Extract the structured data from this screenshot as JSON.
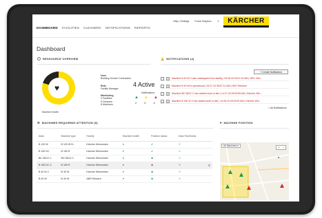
{
  "nav": [
    "DASHBOARD",
    "FACILITIES",
    "CLEANERS",
    "NOTIFICATIONS",
    "REPORTS"
  ],
  "toplinks": {
    "help": "Help | Settings",
    "user": "Frank Simpson"
  },
  "brand": "KÄRCHER",
  "title": "Dashboard",
  "resource": {
    "header": "RESSOURCE OVERVIEW",
    "machine_health_label": "Machine health",
    "user": {
      "label": "User",
      "value": "Building Service Contractors"
    },
    "role": {
      "label": "Role",
      "value": "Facility Manager"
    },
    "monitoring": {
      "label": "Monitoring",
      "facilities": "3 Facilities",
      "cleaners": "5 Cleaners",
      "machines": "8 Machines"
    }
  },
  "notifications": {
    "header": "NOTIFICATIONS (4)",
    "active": "4 Active",
    "status_label": "Notifications",
    "counts": [
      "2",
      "0",
      "4"
    ],
    "create_button": "+ Create Notification",
    "all_link": "> All Notifications",
    "items": [
      "Machine B 40 W 0 was unassigned from facility | 03.06.15 09:47:43 AM | NEG Geb...",
      "Machine B 40 W is operational | 15.07.15 08:57:14 AM | NEG Reinach",
      "Machine BD 38/12 C has started work in site | 14.07.15 09:09:55 AM | Kärcher Win...",
      "Machine B 150 W 2 has started work in site | 10.06.15 09:09:32 AM | Kärcher Win..."
    ]
  },
  "attention": {
    "header": "MACHINES REQUIRING ATTENTION (5)",
    "columns": [
      "Alias",
      "Machine type",
      "Facility",
      "Machine health",
      "Position status",
      "Data Timeliness"
    ],
    "rows": [
      {
        "alias": "B 120 W",
        "type": "B 120 W B...",
        "facility": "Kärcher Winnenden"
      },
      {
        "alias": "B 150 DC",
        "type": "B 150 R",
        "facility": "Kärcher Winnenden"
      },
      {
        "alias": "BD 38/12 C",
        "type": "BD 38/12 C",
        "facility": "Kärcher Winnenden"
      },
      {
        "alias": "B 150 DC 2",
        "type": "B 150 R",
        "facility": "Kärcher Winnenden"
      },
      {
        "alias": "B 40 W 2",
        "type": "B 40 W",
        "facility": "Kärcher Winnenden"
      },
      {
        "alias": "B 40 W",
        "type": "B 40 W",
        "facility": "ABS Reinach"
      }
    ]
  },
  "map": {
    "header": "MACHINE POSITION",
    "dropdown": "All Machines"
  },
  "colors": {
    "accent": "#ffdd00",
    "dark": "#222222",
    "good": "#1f9b4b",
    "bad": "#d72828"
  }
}
